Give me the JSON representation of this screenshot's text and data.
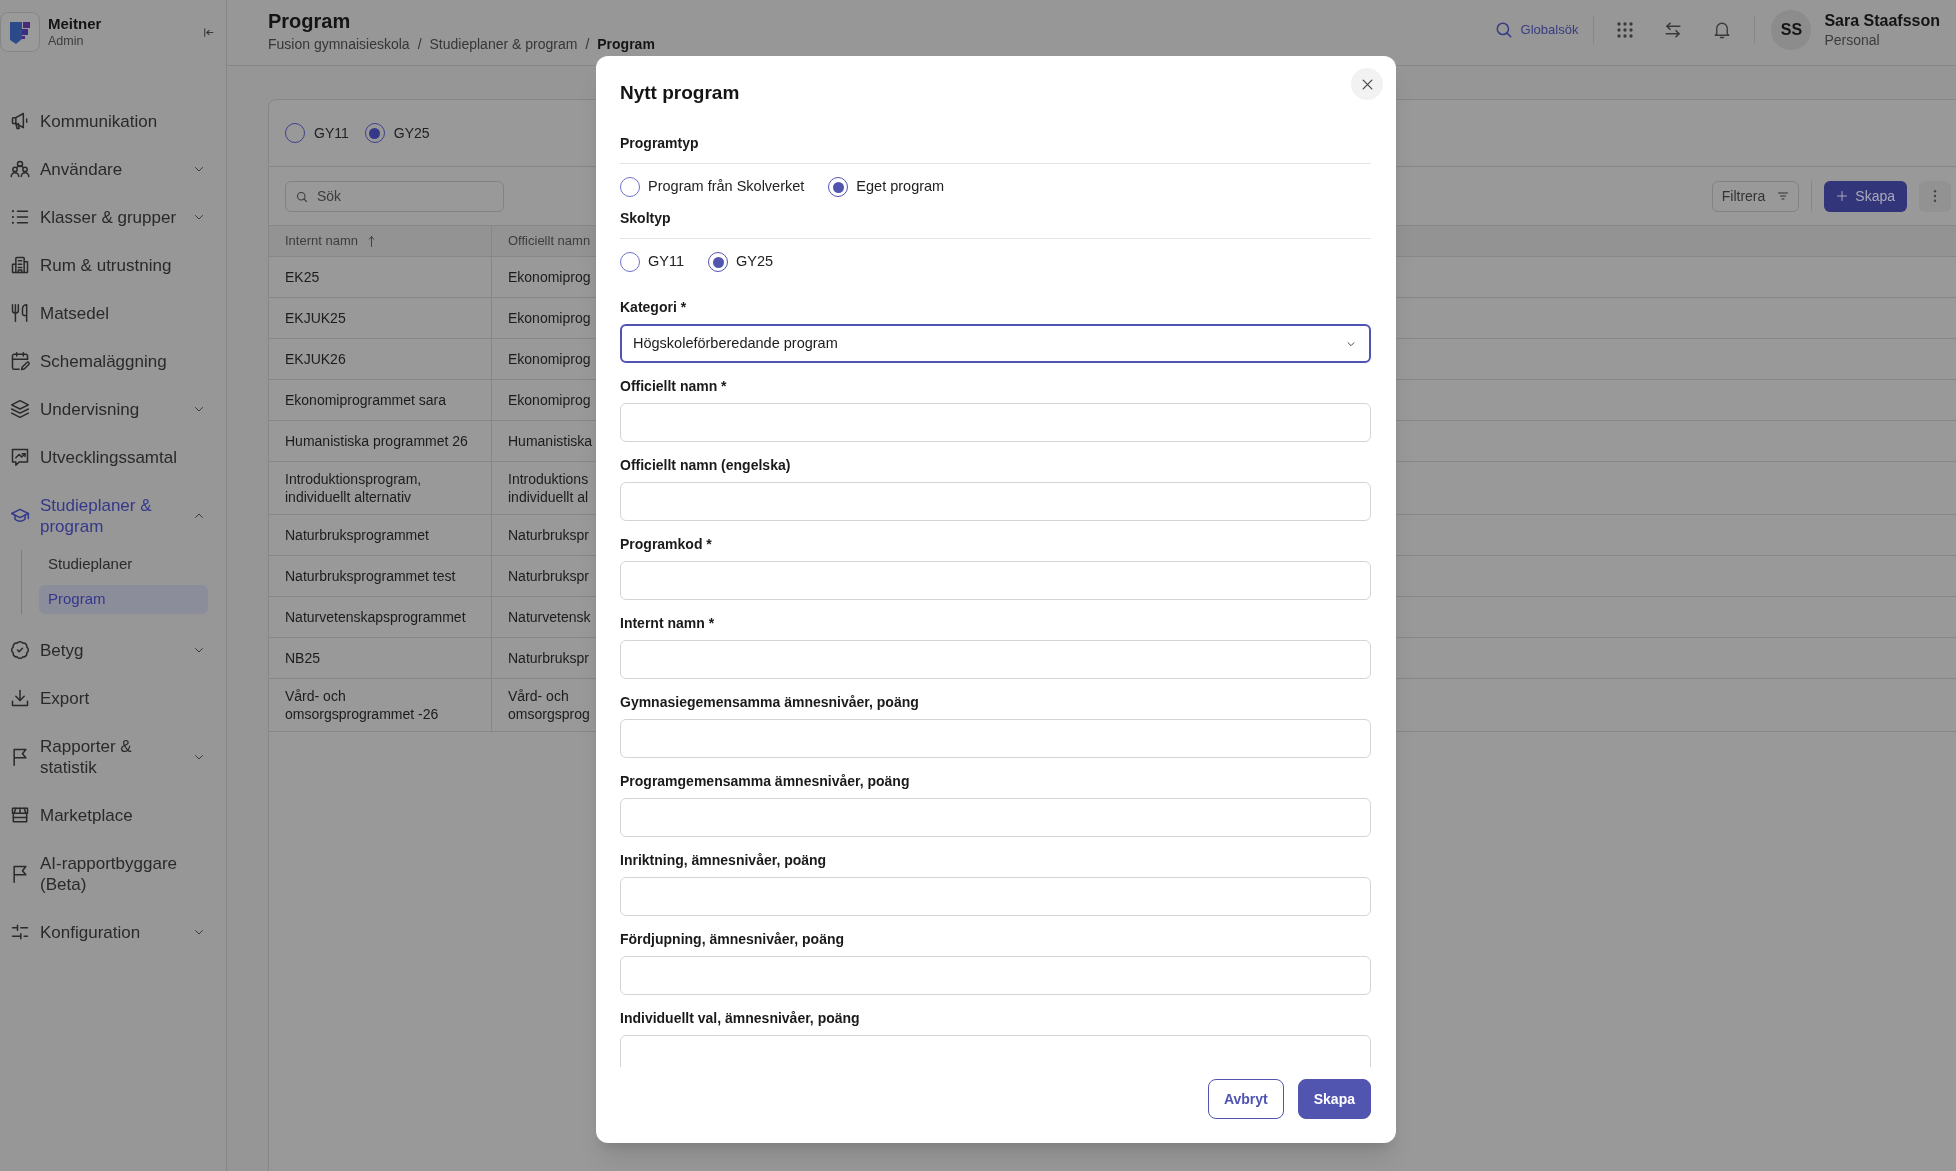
{
  "sidebar": {
    "brand": {
      "name": "Meitner",
      "role": "Admin"
    },
    "items": [
      {
        "label": "Kommunikation",
        "kind": "link",
        "selected": false
      },
      {
        "label": "Användare",
        "kind": "group",
        "expanded": false,
        "selected": false
      },
      {
        "label": "Klasser & grupper",
        "kind": "group",
        "expanded": false,
        "selected": false
      },
      {
        "label": "Rum & utrustning",
        "kind": "link",
        "selected": false
      },
      {
        "label": "Matsedel",
        "kind": "link",
        "selected": false
      },
      {
        "label": "Schemaläggning",
        "kind": "link",
        "selected": false
      },
      {
        "label": "Undervisning",
        "kind": "group",
        "expanded": false,
        "selected": false
      },
      {
        "label": "Utvecklingssamtal",
        "kind": "link",
        "selected": false
      },
      {
        "label": "Studieplaner & program",
        "kind": "group",
        "expanded": true,
        "selected": true,
        "children": [
          {
            "label": "Studieplaner",
            "selected": false
          },
          {
            "label": "Program",
            "selected": true
          }
        ]
      },
      {
        "label": "Betyg",
        "kind": "group",
        "expanded": false,
        "selected": false
      },
      {
        "label": "Export",
        "kind": "link",
        "selected": false
      },
      {
        "label": "Rapporter & statistik",
        "kind": "group",
        "expanded": false,
        "selected": false
      },
      {
        "label": "Marketplace",
        "kind": "link",
        "selected": false
      },
      {
        "label": "AI-rapportbyggare (Beta)",
        "kind": "link",
        "selected": false
      },
      {
        "label": "Konfiguration",
        "kind": "group",
        "expanded": false,
        "selected": false
      }
    ]
  },
  "header": {
    "title": "Program",
    "breadcrumb": [
      {
        "label": "Fusion gymnaisieskola",
        "current": false,
        "separator": "/"
      },
      {
        "label": "Studieplaner & program",
        "current": false,
        "separator": "/"
      },
      {
        "label": "Program",
        "current": true
      }
    ]
  },
  "topbar": {
    "search_label": "Globalsök",
    "user": {
      "initials": "SS",
      "name": "Sara Staafsson",
      "role": "Personal"
    }
  },
  "page": {
    "school_types": [
      {
        "label": "GY11",
        "selected": false
      },
      {
        "label": "GY25",
        "selected": true
      }
    ],
    "search": {
      "placeholder": "Sök"
    },
    "toolbar": {
      "filter": "Filtrera",
      "create": "Skapa"
    },
    "table": {
      "columns": [
        {
          "label": "Internt namn",
          "sorted": true
        },
        {
          "label": "Officiellt namn",
          "sorted": false
        }
      ],
      "rows": [
        [
          "EK25",
          "Ekonomiprog"
        ],
        [
          "EKJUK25",
          "Ekonomiprog"
        ],
        [
          "EKJUK26",
          "Ekonomiprog"
        ],
        [
          "Ekonomiprogrammet sara",
          "Ekonomiprog"
        ],
        [
          "Humanistiska programmet 26",
          "Humanistiska"
        ],
        [
          "Introduktionsprogram, individuellt alternativ",
          "Introduktions individuellt al"
        ],
        [
          "Naturbruksprogrammet",
          "Naturbrukspr"
        ],
        [
          "Naturbruksprogrammet test",
          "Naturbrukspr"
        ],
        [
          "Naturvetenskapsprogrammet",
          "Naturvetensk"
        ],
        [
          "NB25",
          "Naturbrukspr"
        ],
        [
          "Vård- och omsorgsprogrammet -26",
          "Vård- och omsorgsprog"
        ]
      ]
    }
  },
  "dialog": {
    "title": "Nytt program",
    "groups": [
      {
        "heading": "Programtyp",
        "options": [
          {
            "label": "Program från Skolverket",
            "selected": false
          },
          {
            "label": "Eget program",
            "selected": true
          }
        ]
      },
      {
        "heading": "Skoltyp",
        "options": [
          {
            "label": "GY11",
            "selected": false
          },
          {
            "label": "GY25",
            "selected": true
          }
        ]
      }
    ],
    "fields": [
      {
        "kind": "select",
        "label": "Kategori *",
        "value": "Högskoleförberedande program",
        "focused": true
      },
      {
        "kind": "text",
        "label": "Officiellt namn *",
        "focused": false
      },
      {
        "kind": "text",
        "label": "Officiellt namn (engelska)",
        "focused": false
      },
      {
        "kind": "text",
        "label": "Programkod *",
        "focused": false
      },
      {
        "kind": "text",
        "label": "Internt namn *",
        "focused": false
      },
      {
        "kind": "text",
        "label": "Gymnasiegemensamma ämnesnivåer, poäng",
        "focused": false
      },
      {
        "kind": "text",
        "label": "Programgemensamma ämnesnivåer, poäng",
        "focused": false
      },
      {
        "kind": "text",
        "label": "Inriktning, ämnesnivåer, poäng",
        "focused": false
      },
      {
        "kind": "text",
        "label": "Fördjupning, ämnesnivåer, poäng",
        "focused": false
      },
      {
        "kind": "text",
        "label": "Individuellt val, ämnesnivåer, poäng",
        "focused": false
      }
    ],
    "buttons": [
      {
        "label": "Avbryt",
        "kind": "secondary"
      },
      {
        "label": "Skapa",
        "kind": "primary"
      }
    ]
  }
}
